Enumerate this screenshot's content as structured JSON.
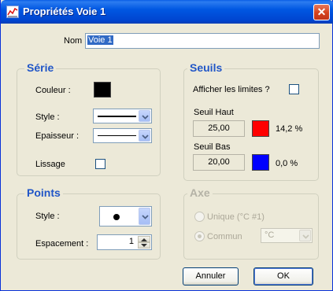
{
  "window": {
    "title": "Propriétés Voie 1",
    "close_symbol": "✕"
  },
  "nom": {
    "label": "Nom :",
    "value": "Voie 1"
  },
  "serie": {
    "title": "Série",
    "couleur_label": "Couleur :",
    "couleur_color": "#000000",
    "style_label": "Style :",
    "epaisseur_label": "Epaisseur :",
    "lissage_label": "Lissage"
  },
  "seuils": {
    "title": "Seuils",
    "afficher_label": "Afficher les limites ?",
    "haut_label": "Seuil Haut",
    "haut_value": "25,00",
    "haut_color": "#ff0000",
    "haut_percent": "14,2 %",
    "bas_label": "Seuil Bas",
    "bas_value": "20,00",
    "bas_color": "#0000ff",
    "bas_percent": "0,0 %"
  },
  "points": {
    "title": "Points",
    "style_label": "Style :",
    "espacement_label": "Espacement :",
    "espacement_value": "1"
  },
  "axe": {
    "title": "Axe",
    "unique_label": "Unique (°C #1)",
    "commun_label": "Commun",
    "unit_value": "°C"
  },
  "buttons": {
    "cancel": "Annuler",
    "ok": "OK"
  }
}
